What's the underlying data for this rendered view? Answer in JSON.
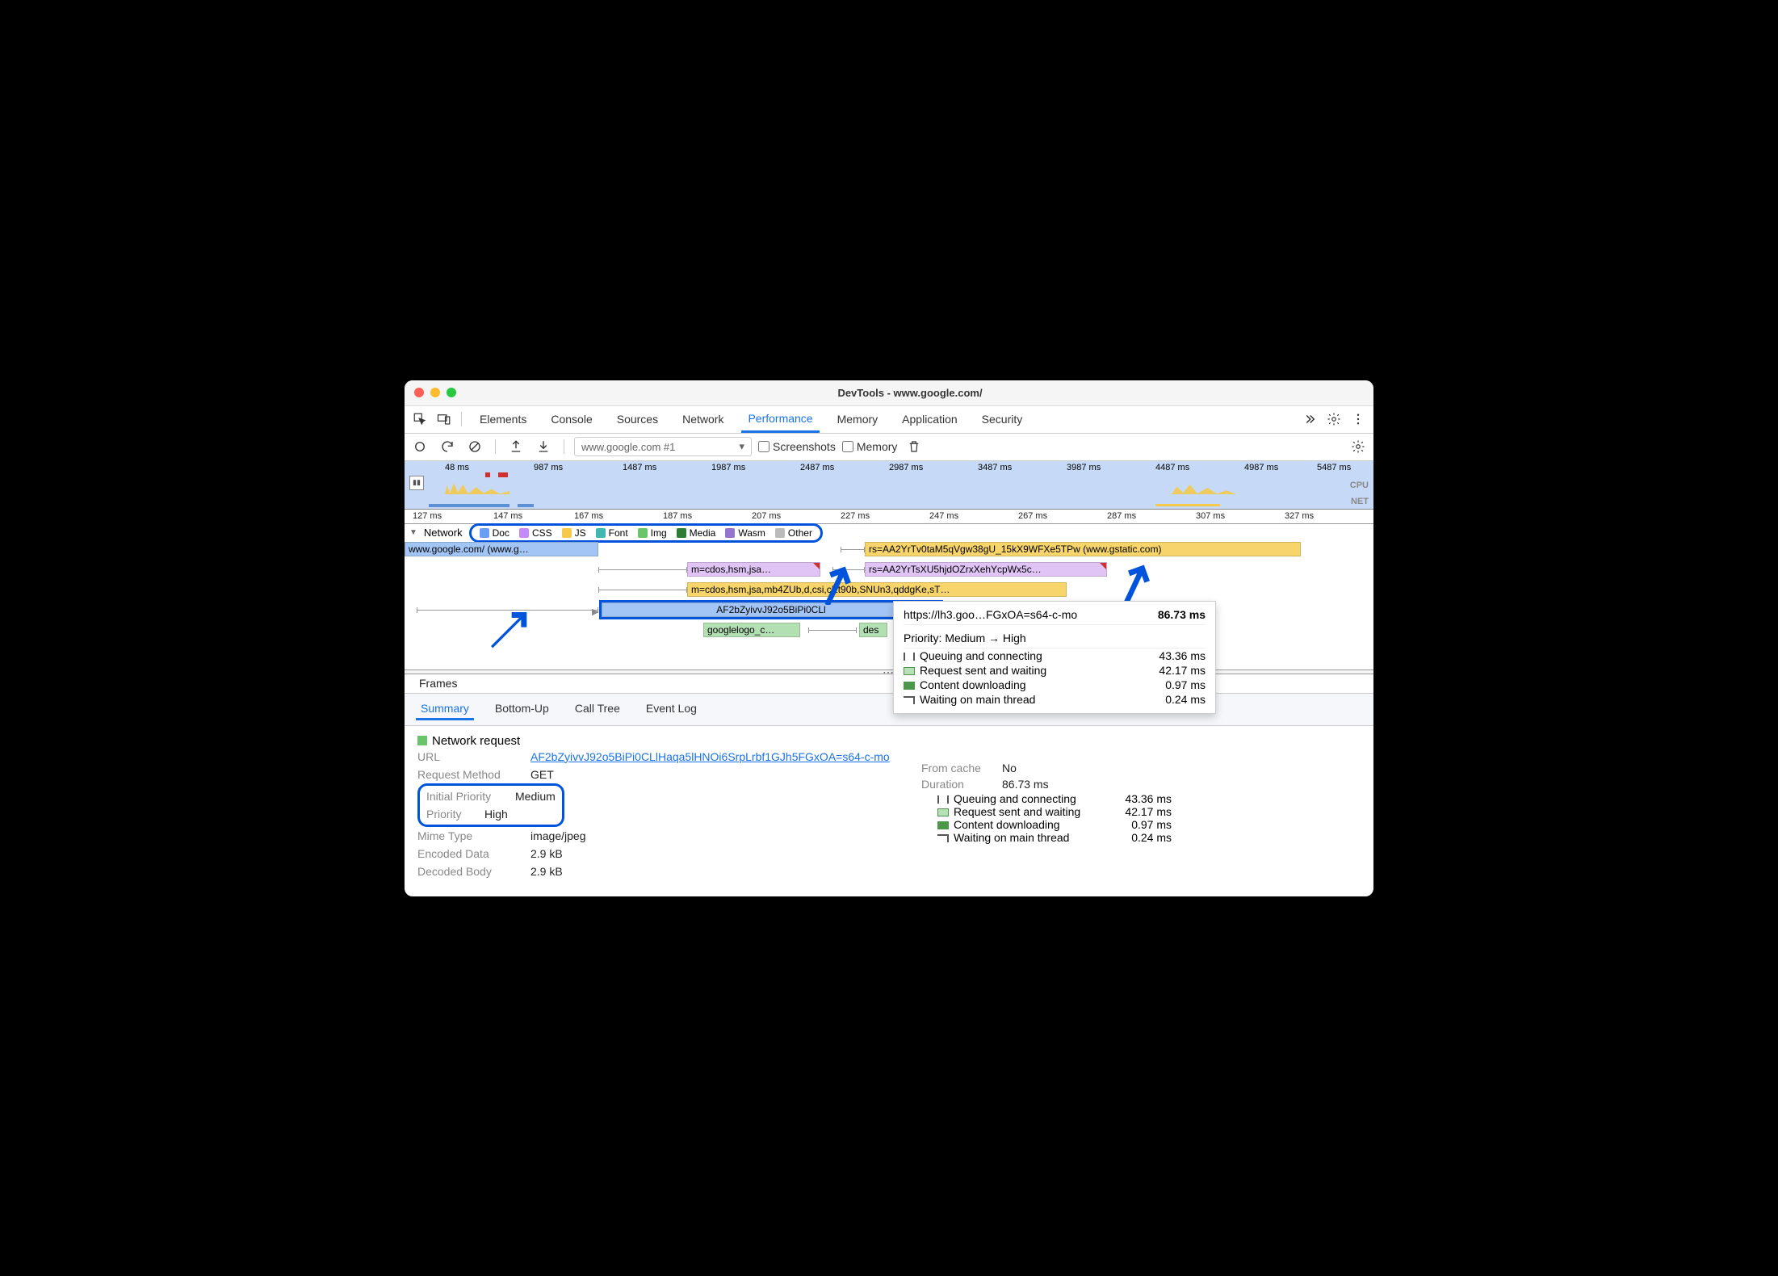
{
  "window": {
    "title": "DevTools - www.google.com/"
  },
  "mainTabs": [
    "Elements",
    "Console",
    "Sources",
    "Network",
    "Performance",
    "Memory",
    "Application",
    "Security"
  ],
  "activeTab": "Performance",
  "toolbar": {
    "selection": "www.google.com #1",
    "screenshots_label": "Screenshots",
    "memory_label": "Memory"
  },
  "overview": {
    "ticks": [
      "48  ms",
      "987 ms",
      "1487 ms",
      "1987 ms",
      "2487 ms",
      "2987 ms",
      "3487 ms",
      "3987 ms",
      "4487 ms",
      "4987 ms",
      "5487 ms"
    ],
    "cpu_label": "CPU",
    "net_label": "NET"
  },
  "ruler": [
    "127 ms",
    "147 ms",
    "167 ms",
    "187 ms",
    "207 ms",
    "227 ms",
    "247 ms",
    "267 ms",
    "287 ms",
    "307 ms",
    "327 ms"
  ],
  "netHeader": {
    "label": "Network",
    "legend": [
      "Doc",
      "CSS",
      "JS",
      "Font",
      "Img",
      "Media",
      "Wasm",
      "Other"
    ]
  },
  "bars": {
    "b1": "www.google.com/ (www.g…",
    "b2": "rs=AA2YrTv0taM5qVgw38gU_15kX9WFXe5TPw (www.gstatic.com)",
    "b3": "m=cdos,hsm,jsa…",
    "b4": "rs=AA2YrTsXU5hjdOZrxXehYcpWx5c…",
    "b5": "m=cdos,hsm,jsa,mb4ZUb,d,csi,cEt90b,SNUn3,qddgKe,sT…",
    "b6": "AF2bZyivvJ92o5BiPi0CLl",
    "b7": "googlelogo_c…",
    "b8": "des"
  },
  "tooltip": {
    "url": "https://lh3.goo…FGxOA=s64-c-mo",
    "total": "86.73 ms",
    "priority": "Priority: Medium → High",
    "rows": [
      {
        "label": "Queuing and connecting",
        "val": "43.36 ms"
      },
      {
        "label": "Request sent and waiting",
        "val": "42.17 ms"
      },
      {
        "label": "Content downloading",
        "val": "0.97 ms"
      },
      {
        "label": "Waiting on main thread",
        "val": "0.24 ms"
      }
    ]
  },
  "frames_label": "Frames",
  "detailTabs": [
    "Summary",
    "Bottom-Up",
    "Call Tree",
    "Event Log"
  ],
  "summary": {
    "title": "Network request",
    "url_label": "URL",
    "url": "AF2bZyivvJ92o5BiPi0CLlHaqa5lHNOi6SrpLrbf1GJh5FGxOA=s64-c-mo",
    "method_label": "Request Method",
    "method": "GET",
    "init_prio_label": "Initial Priority",
    "init_prio": "Medium",
    "prio_label": "Priority",
    "prio": "High",
    "mime_label": "Mime Type",
    "mime": "image/jpeg",
    "enc_label": "Encoded Data",
    "enc": "2.9 kB",
    "dec_label": "Decoded Body",
    "dec": "2.9 kB",
    "cache_label": "From cache",
    "cache": "No",
    "dur_label": "Duration",
    "dur": "86.73 ms",
    "breakdown": [
      {
        "label": "Queuing and connecting",
        "val": "43.36 ms"
      },
      {
        "label": "Request sent and waiting",
        "val": "42.17 ms"
      },
      {
        "label": "Content downloading",
        "val": "0.97 ms"
      },
      {
        "label": "Waiting on main thread",
        "val": "0.24 ms"
      }
    ]
  }
}
